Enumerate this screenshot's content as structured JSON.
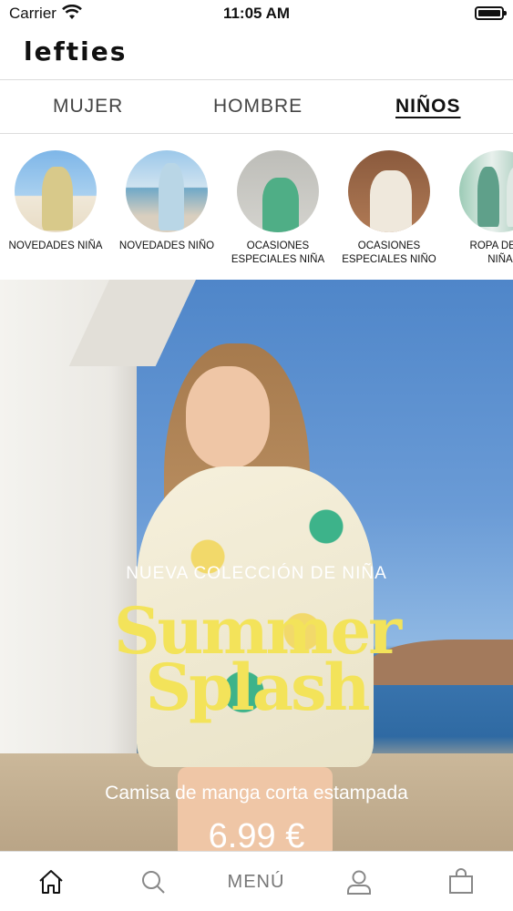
{
  "status_bar": {
    "carrier": "Carrier",
    "time": "11:05 AM"
  },
  "header": {
    "brand": "lefties"
  },
  "tabs": [
    {
      "label": "MUJER",
      "active": false
    },
    {
      "label": "HOMBRE",
      "active": false
    },
    {
      "label": "NIÑOS",
      "active": true
    }
  ],
  "categories": [
    {
      "label": "NOVEDADES NIÑA"
    },
    {
      "label": "NOVEDADES NIÑO"
    },
    {
      "label": "OCASIONES\nESPECIALES NIÑA"
    },
    {
      "label": "OCASIONES\nESPECIALES NIÑO"
    },
    {
      "label": "ROPA DEPO\nNIÑA"
    }
  ],
  "hero": {
    "kicker": "NUEVA COLECCIÓN DE NIÑA",
    "title_line1": "Summer",
    "title_line2": "Splash",
    "subtitle": "Camisa de manga corta estampada",
    "price": "6.99 €"
  },
  "bottom_nav": {
    "home_icon": "home-icon",
    "search_icon": "search-icon",
    "menu_label": "MENÚ",
    "account_icon": "user-icon",
    "bag_icon": "shopping-bag-icon"
  },
  "colors": {
    "accent_title": "#f3e35a",
    "text": "#111111",
    "divider": "#dddddd"
  }
}
